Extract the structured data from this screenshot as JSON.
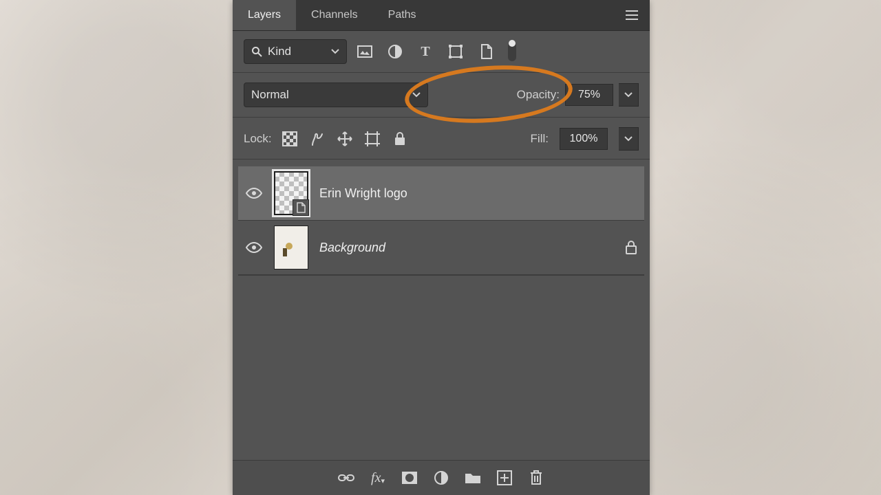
{
  "tabs": {
    "layers": "Layers",
    "channels": "Channels",
    "paths": "Paths"
  },
  "filter": {
    "kind": "Kind"
  },
  "blend": {
    "mode": "Normal"
  },
  "opacity": {
    "label": "Opacity:",
    "value": "75%"
  },
  "lock": {
    "label": "Lock:"
  },
  "fill": {
    "label": "Fill:",
    "value": "100%"
  },
  "layers": [
    {
      "name": "Erin Wright logo"
    },
    {
      "name": "Background"
    }
  ]
}
